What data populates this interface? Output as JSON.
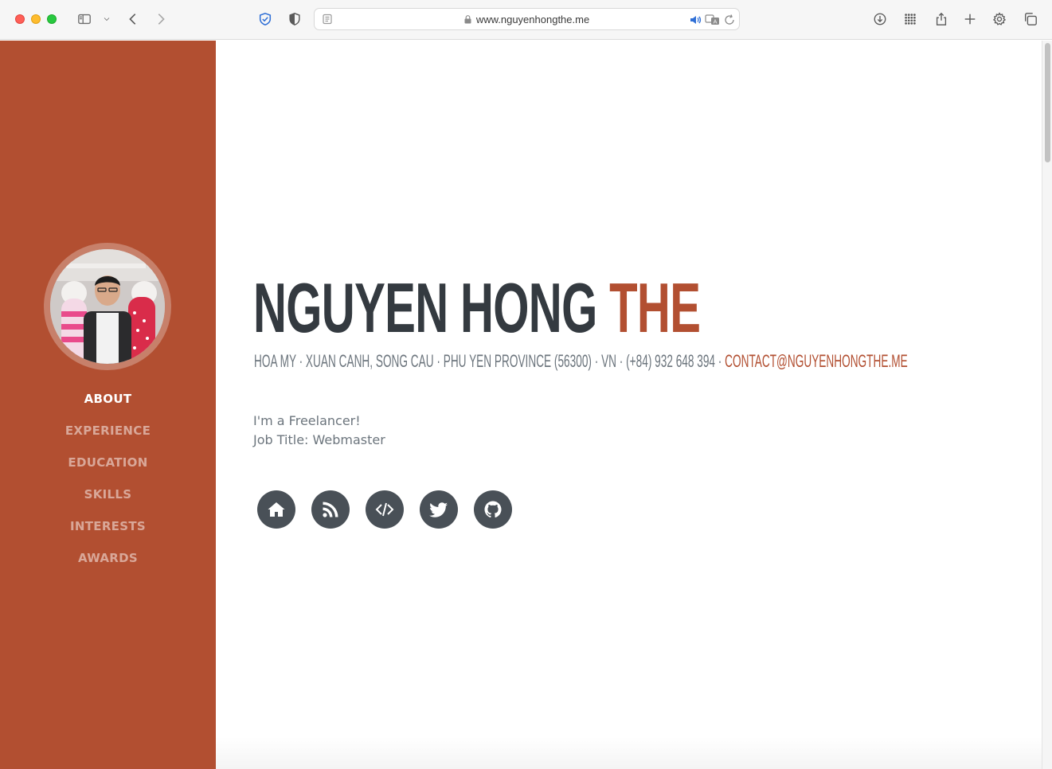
{
  "browser": {
    "url": "www.nguyenhongthe.me",
    "icons": [
      "sidebar-toggle-icon",
      "chevron-down-icon",
      "back-icon",
      "forward-icon",
      "privacy-shield-icon",
      "half-circle-shield-icon",
      "reader-icon",
      "lock-icon",
      "speaker-icon",
      "translate-icon",
      "reload-icon",
      "download-icon",
      "grid-icon",
      "share-icon",
      "plus-icon",
      "gear-icon",
      "tabs-overview-icon"
    ]
  },
  "sidebar": {
    "nav": [
      {
        "label": "ABOUT",
        "active": true
      },
      {
        "label": "EXPERIENCE",
        "active": false
      },
      {
        "label": "EDUCATION",
        "active": false
      },
      {
        "label": "SKILLS",
        "active": false
      },
      {
        "label": "INTERESTS",
        "active": false
      },
      {
        "label": "AWARDS",
        "active": false
      }
    ]
  },
  "profile": {
    "first_name": "NGUYEN HONG",
    "last_name": "THE",
    "address": "HOA MY · XUAN CANH, SONG CAU · PHU YEN PROVINCE (56300) · VN · (+84) 932 648 394 ·",
    "email": "CONTACT@NGUYENHONGTHE.ME",
    "lead_line1": "I'm a Freelancer!",
    "lead_line2": "Job Title: Webmaster"
  },
  "social": [
    "home-icon",
    "rss-icon",
    "code-icon",
    "twitter-icon",
    "github-icon"
  ],
  "colors": {
    "accent": "#b24f31",
    "heading": "#343a40",
    "muted": "#6c757d",
    "social_bg": "#495057"
  }
}
